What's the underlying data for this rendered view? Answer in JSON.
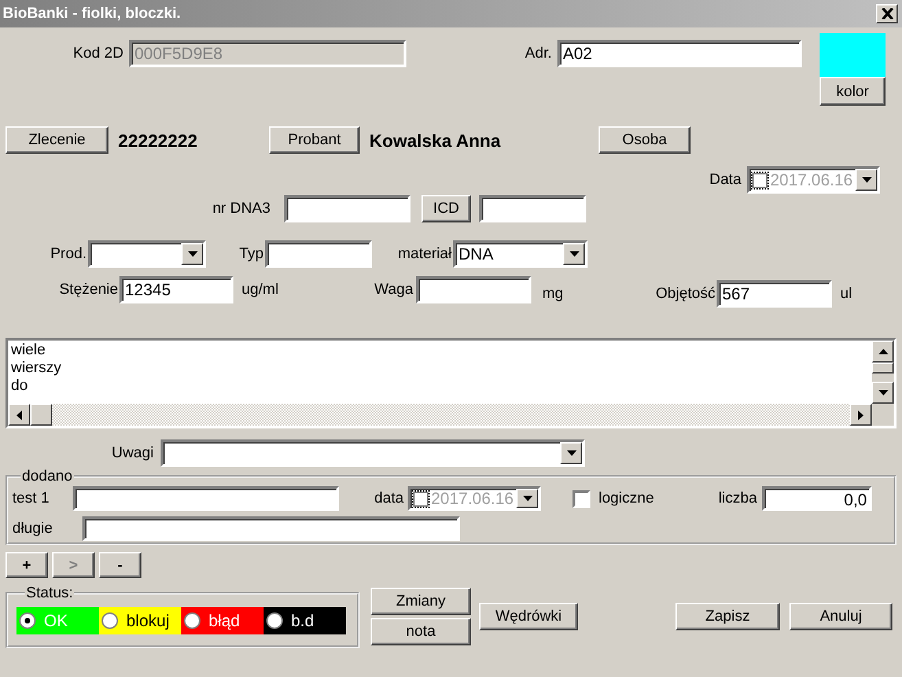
{
  "window": {
    "title": "BioBanki - fiolki, bloczki."
  },
  "kod_2d": {
    "label": "Kod 2D",
    "value": "000F5D9E8",
    "disabled": true
  },
  "adr": {
    "label": "Adr.",
    "value": "A02"
  },
  "swatch": {
    "color": "#00ffff",
    "button": "kolor"
  },
  "zlecenie": {
    "button": "Zlecenie",
    "value": "22222222"
  },
  "probant": {
    "button": "Probant",
    "value": "Kowalska Anna"
  },
  "osoba": {
    "button": "Osoba"
  },
  "data": {
    "label": "Data",
    "checked": false,
    "value": "2017.06.16"
  },
  "nr_dna3": {
    "label": "nr DNA3",
    "button": "ICD"
  },
  "prod": {
    "label": "Prod."
  },
  "typ": {
    "label": "Typ"
  },
  "material": {
    "label": "materiał",
    "value": "DNA"
  },
  "stezenie": {
    "label": "Stężenie",
    "value": "12345",
    "unit": "ug/ml"
  },
  "waga": {
    "label": "Waga",
    "unit": "mg"
  },
  "objetosc": {
    "label": "Objętość",
    "value": "567",
    "unit": "ul"
  },
  "memo": {
    "lines": [
      "wiele",
      "wierszy",
      "do"
    ]
  },
  "uwagi": {
    "label": "Uwagi"
  },
  "dodano": {
    "title": "dodano",
    "test_1": {
      "label": "test 1"
    },
    "data": {
      "label": "data",
      "checked": false,
      "value": "2017.06.16"
    },
    "logiczne": {
      "label": "logiczne",
      "checked": false
    },
    "liczba": {
      "label": "liczba",
      "value": "0,0"
    },
    "dlugie": {
      "label": "długie"
    }
  },
  "nav_buttons": [
    {
      "label": "+",
      "disabled": false
    },
    {
      "label": ">",
      "disabled": true
    },
    {
      "label": "-",
      "disabled": false
    }
  ],
  "status": {
    "title": "Status:",
    "options": [
      {
        "label": "OK",
        "selected": true,
        "color": "#00ff00"
      },
      {
        "label": "blokuj",
        "selected": false,
        "color": "#ffff00"
      },
      {
        "label": "błąd",
        "selected": false,
        "color": "#ff0000"
      },
      {
        "label": "b.d",
        "selected": false,
        "color": "#000000"
      }
    ]
  },
  "buttons": {
    "zmiany": "Zmiany",
    "nota": "nota",
    "wedrowki": "Wędrówki",
    "zapisz": "Zapisz",
    "anuluj": "Anuluj"
  }
}
